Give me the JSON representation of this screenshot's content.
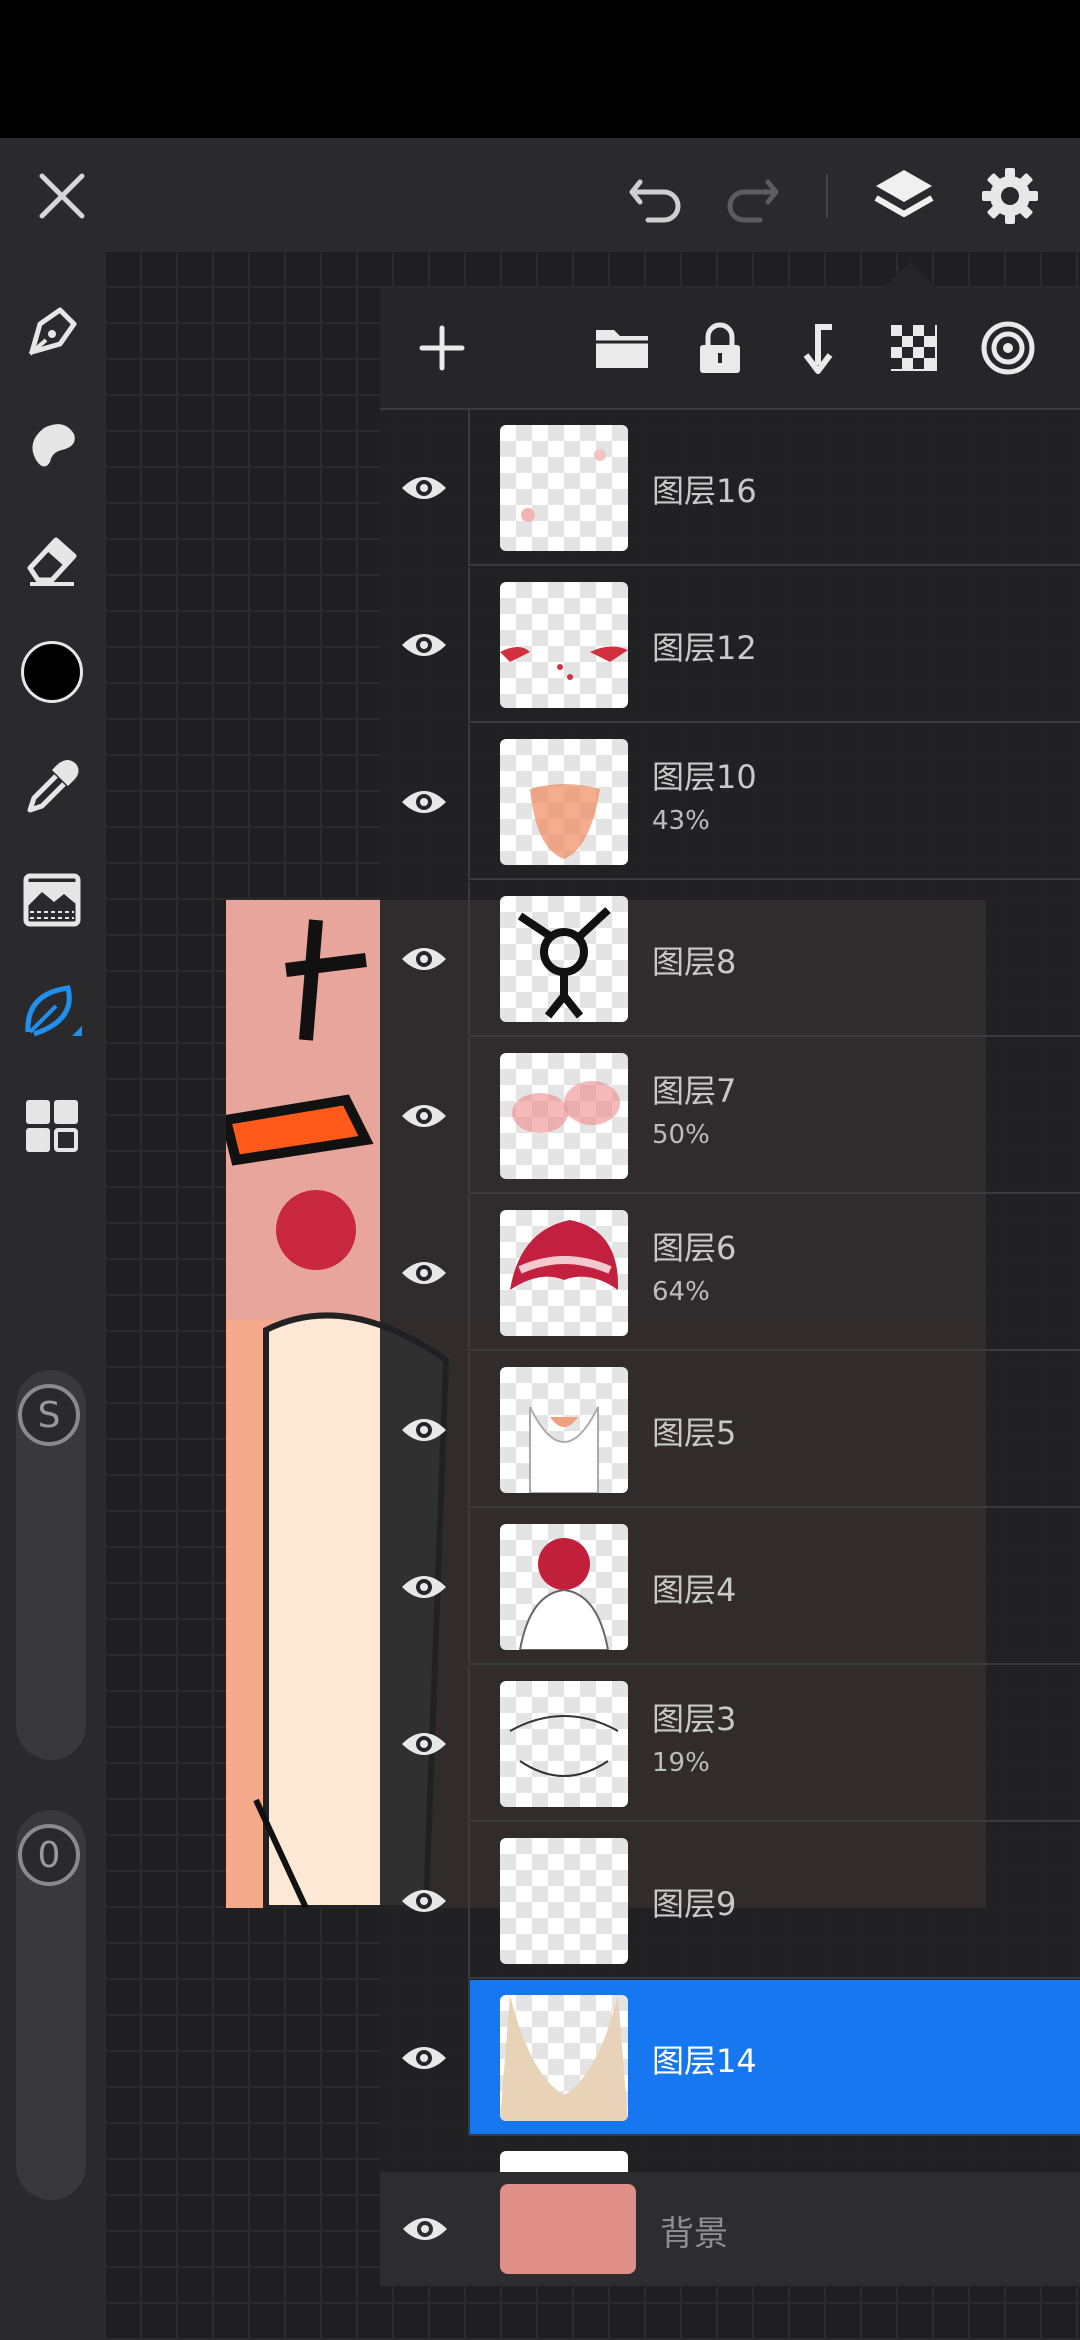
{
  "toolbar": {
    "close": "close-icon",
    "undo": "undo-icon",
    "redo": "redo-icon",
    "layers": "layers-icon",
    "settings": "gear-icon"
  },
  "sidebar": {
    "tools": [
      "brush-icon",
      "smudge-icon",
      "eraser-icon",
      "color-swatch",
      "eyedropper-icon",
      "adjust-icon",
      "selection-icon",
      "gallery-icon"
    ],
    "current_color": "#000000",
    "accent": "#1f8ff0",
    "size_label": "S",
    "opacity_label": "0"
  },
  "layers_toolbar": {
    "add": "plus-icon",
    "group": "folder-icon",
    "lock": "lock-icon",
    "merge": "merge-down-icon",
    "transparency": "checker-icon",
    "blend": "target-icon"
  },
  "layers": [
    {
      "name": "图层16",
      "opacity": ""
    },
    {
      "name": "图层12",
      "opacity": ""
    },
    {
      "name": "图层10",
      "opacity": "43%"
    },
    {
      "name": "图层8",
      "opacity": ""
    },
    {
      "name": "图层7",
      "opacity": "50%"
    },
    {
      "name": "图层6",
      "opacity": "64%"
    },
    {
      "name": "图层5",
      "opacity": ""
    },
    {
      "name": "图层4",
      "opacity": ""
    },
    {
      "name": "图层3",
      "opacity": "19%"
    },
    {
      "name": "图层9",
      "opacity": ""
    },
    {
      "name": "图层14",
      "opacity": ""
    }
  ],
  "selected_layer": "图层14",
  "background_layer": {
    "name": "背景",
    "color": "#e08e88"
  }
}
